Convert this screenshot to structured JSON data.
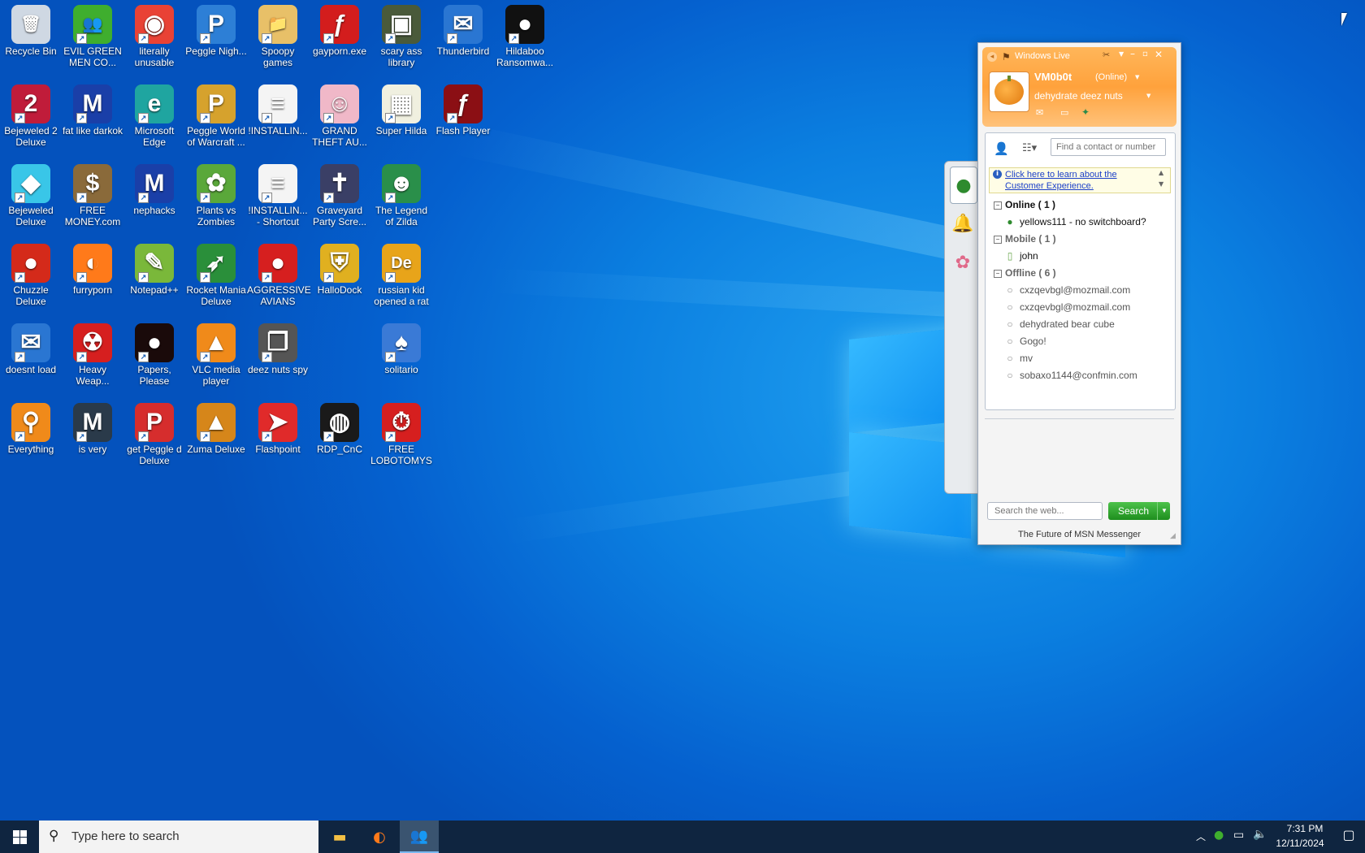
{
  "desktop": {
    "icons": [
      {
        "label": "Recycle Bin",
        "icon": "recycle-bin-icon",
        "glyph": "🗑",
        "color": "#cfd8e3"
      },
      {
        "label": "EVIL GREEN MEN CO...",
        "icon": "messenger-people-icon",
        "glyph": "👥",
        "color": "#3fae2e"
      },
      {
        "label": "literally unusable",
        "icon": "chrome-icon",
        "glyph": "◉",
        "color": "#e94235"
      },
      {
        "label": "Peggle Nigh...",
        "icon": "peggle-icon",
        "glyph": "P",
        "color": "#2d7fd6"
      },
      {
        "label": "Spoopy games",
        "icon": "folder-icon",
        "glyph": "📁",
        "color": "#e8c068"
      },
      {
        "label": "gayporn.exe",
        "icon": "flash-icon",
        "glyph": "ƒ",
        "color": "#d31d1d"
      },
      {
        "label": "scary ass library",
        "icon": "library-icon",
        "glyph": "▣",
        "color": "#4a5a3a"
      },
      {
        "label": "Thunderbird",
        "icon": "thunderbird-icon",
        "glyph": "✉",
        "color": "#2a76d2"
      },
      {
        "label": "Hildaboo Ransomwa...",
        "icon": "hildaboo-icon",
        "glyph": "●",
        "color": "#111111"
      },
      {
        "label": "Bejeweled 2 Deluxe",
        "icon": "bejeweled2-icon",
        "glyph": "2",
        "color": "#c01c3a"
      },
      {
        "label": "fat like darkok",
        "icon": "mpi-icon",
        "glyph": "M",
        "color": "#1a3fa8"
      },
      {
        "label": "Microsoft Edge",
        "icon": "edge-icon",
        "glyph": "e",
        "color": "#1fa5a0"
      },
      {
        "label": "Peggle World of Warcraft ...",
        "icon": "peggle-wow-icon",
        "glyph": "P",
        "color": "#d6a22d"
      },
      {
        "label": "!INSTALLIN...",
        "icon": "text-file-icon",
        "glyph": "≡",
        "color": "#f4f4f4"
      },
      {
        "label": "GRAND THEFT AU...",
        "icon": "anime-girl-icon",
        "glyph": "☺",
        "color": "#f0b8c8"
      },
      {
        "label": "Super Hilda",
        "icon": "super-hilda-icon",
        "glyph": "▦",
        "color": "#f0f0e0"
      },
      {
        "label": "Flash Player",
        "icon": "flash-player-icon",
        "glyph": "ƒ",
        "color": "#8b0f14"
      },
      {
        "label": "Bejeweled Deluxe",
        "icon": "gem-icon",
        "glyph": "◆",
        "color": "#39c6e8"
      },
      {
        "label": "FREE MONEY.com",
        "icon": "money-bag-icon",
        "glyph": "$",
        "color": "#8a6a3a"
      },
      {
        "label": "nephacks",
        "icon": "mpi-icon",
        "glyph": "M",
        "color": "#1a3fa8"
      },
      {
        "label": "Plants vs Zombies",
        "icon": "pvz-icon",
        "glyph": "✿",
        "color": "#5aa83a"
      },
      {
        "label": "!INSTALLIN... - Shortcut",
        "icon": "text-file-icon",
        "glyph": "≡",
        "color": "#f4f4f4"
      },
      {
        "label": "Graveyard Party Scre...",
        "icon": "graveyard-icon",
        "glyph": "✝",
        "color": "#3a3f66"
      },
      {
        "label": "The Legend of Zilda",
        "icon": "zilda-icon",
        "glyph": "☻",
        "color": "#2a8f4a"
      },
      {
        "label": "Chuzzle Deluxe",
        "icon": "chuzzle-icon",
        "glyph": "●",
        "color": "#d42a1a"
      },
      {
        "label": "furryporn",
        "icon": "firefox-icon",
        "glyph": "◐",
        "color": "#ff7a1a"
      },
      {
        "label": "Notepad++",
        "icon": "notepadpp-icon",
        "glyph": "✎",
        "color": "#7ab83a"
      },
      {
        "label": "Rocket Mania Deluxe",
        "icon": "rocket-icon",
        "glyph": "➶",
        "color": "#2a8f3a"
      },
      {
        "label": "AGGRESSIVE AVIANS",
        "icon": "angry-bird-icon",
        "glyph": "●",
        "color": "#d61f1f"
      },
      {
        "label": "HalloDock",
        "icon": "shield-icon",
        "glyph": "⛨",
        "color": "#e0b020"
      },
      {
        "label": "russian kid opened a rat",
        "icon": "de-icon",
        "glyph": "De",
        "color": "#e8a41a"
      },
      {
        "label": "doesnt load",
        "icon": "thunderbird-icon",
        "glyph": "✉",
        "color": "#2a76d2"
      },
      {
        "label": "Heavy Weap...",
        "icon": "radiation-icon",
        "glyph": "☢",
        "color": "#d61f1f"
      },
      {
        "label": "Papers, Please",
        "icon": "papers-please-icon",
        "glyph": "●",
        "color": "#1a0a0a"
      },
      {
        "label": "VLC media player",
        "icon": "vlc-icon",
        "glyph": "▲",
        "color": "#f08a1a"
      },
      {
        "label": "deez nuts spy",
        "icon": "windows-stack-icon",
        "glyph": "❐",
        "color": "#555555"
      },
      {
        "label": "solitario",
        "icon": "solitaire-icon",
        "glyph": "♠",
        "color": "#3a7ad6"
      },
      {
        "label": "Everything",
        "icon": "magnifier-icon",
        "glyph": "⚲",
        "color": "#f08a1a"
      },
      {
        "label": "is very",
        "icon": "mpi-dark-icon",
        "glyph": "M",
        "color": "#2a3a4a"
      },
      {
        "label": "get Peggle d Deluxe",
        "icon": "peggle-icon",
        "glyph": "P",
        "color": "#d62d2d"
      },
      {
        "label": "Zuma Deluxe",
        "icon": "zuma-icon",
        "glyph": "▲",
        "color": "#d6861a"
      },
      {
        "label": "Flashpoint",
        "icon": "flashpoint-icon",
        "glyph": "➤",
        "color": "#e02a2a"
      },
      {
        "label": "RDP_CnC",
        "icon": "rdp-icon",
        "glyph": "◍",
        "color": "#1a1a1a"
      },
      {
        "label": "FREE LOBOTOMYS",
        "icon": "stopwatch-icon",
        "glyph": "⏱",
        "color": "#d61f1f"
      }
    ]
  },
  "messenger": {
    "brand": "Windows Live",
    "display_name": "VM0b0t",
    "status": "(Online)",
    "personal_message": "dehydrate deez nuts",
    "search_placeholder": "Find a contact or number",
    "info_link": "Click here to learn about the Customer Experience.",
    "groups": [
      {
        "label": "Online ( 1 )",
        "contacts": [
          "yellows111 - no switchboard?"
        ]
      },
      {
        "label": "Mobile ( 1 )",
        "contacts": [
          "john"
        ]
      },
      {
        "label": "Offline ( 6 )",
        "contacts": [
          "cxzqevbgl@mozmail.com",
          "cxzqevbgl@mozmail.com",
          "dehydrated bear cube",
          "Gogo!",
          "mv",
          "sobaxo1144@confmin.com"
        ]
      }
    ],
    "web_search_placeholder": "Search the web...",
    "web_search_button": "Search",
    "footer": "The Future of MSN Messenger",
    "colors": {
      "header": "#ffa23c",
      "online": "#2e8b2e",
      "mobile": "#6aa84f"
    }
  },
  "taskbar": {
    "search_placeholder": "Type here to search",
    "time": "7:31 PM",
    "date": "12/11/2024"
  }
}
